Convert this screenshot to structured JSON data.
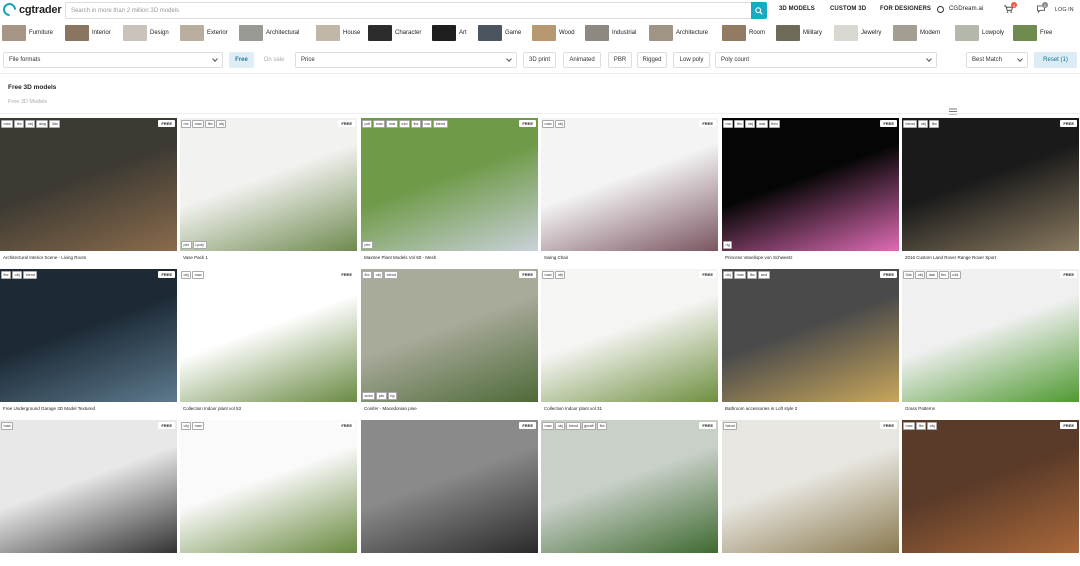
{
  "header": {
    "logo_text": "cgtrader",
    "search_placeholder": "Search in more than 2 million 3D models",
    "nav": [
      "3D MODELS",
      "CUSTOM 3D",
      "FOR DESIGNERS",
      "CGDream.ai"
    ],
    "cart_count": "0",
    "user_count": "0",
    "login_label": "LOG IN"
  },
  "categories": [
    {
      "label": "Furniture",
      "color": "#a79686"
    },
    {
      "label": "Interior",
      "color": "#8a7560"
    },
    {
      "label": "Design",
      "color": "#c9c3bb"
    },
    {
      "label": "Exterior",
      "color": "#b9ad9d"
    },
    {
      "label": "Architectural",
      "color": "#9a9a95"
    },
    {
      "label": "House",
      "color": "#c0b7a8"
    },
    {
      "label": "Character",
      "color": "#2c2c2c"
    },
    {
      "label": "Art",
      "color": "#1e1e1e"
    },
    {
      "label": "Game",
      "color": "#4b5560"
    },
    {
      "label": "Wood",
      "color": "#b89870"
    },
    {
      "label": "Industrial",
      "color": "#8d8880"
    },
    {
      "label": "Architecture",
      "color": "#a09585"
    },
    {
      "label": "Room",
      "color": "#937a63"
    },
    {
      "label": "Military",
      "color": "#6e6a58"
    },
    {
      "label": "Jewelry",
      "color": "#d8d8d0"
    },
    {
      "label": "Modern",
      "color": "#a49d92"
    },
    {
      "label": "Lowpoly",
      "color": "#b3b9aa"
    },
    {
      "label": "Free",
      "color": "#6f8b4e"
    }
  ],
  "filters": {
    "file_formats": "File formats",
    "free": "Free",
    "on_sale": "On sale",
    "price": "Price",
    "print3d": "3D print",
    "animated": "Animated",
    "pbr": "PBR",
    "rigged": "Rigged",
    "lowpoly": "Low poly",
    "poly_count": "Poly count",
    "sort": "Best Match",
    "reset": "Reset (1)"
  },
  "page": {
    "title": "Free 3D models",
    "breadcrumb": "Free 3D Models"
  },
  "free_label": "FREE",
  "products": [
    {
      "title": "Architectural Interior Scene - Living Room",
      "formats": [
        "max",
        "fbx",
        "obj",
        "dwg",
        "3ds"
      ],
      "bottom": [],
      "bg": "#3d3a33",
      "bg2": "#8a6b4c"
    },
    {
      "title": "Vase Pack 1",
      "formats": [
        "mx",
        "max",
        "fbx",
        "obj"
      ],
      "bottom": [
        "pbr",
        "l-poly"
      ],
      "bg": "#f2f2f0",
      "bg2": "#6f8a50"
    },
    {
      "title": "Maxtree Plant Models Vol 60 - Mesh",
      "formats": [
        "pdf",
        "max",
        "mat",
        "c4d",
        "fbx",
        "ma",
        "blend"
      ],
      "bottom": [
        "pbr"
      ],
      "bg": "#6f9a48",
      "bg2": "#c9d1d9"
    },
    {
      "title": "Swing Chair",
      "formats": [
        "max",
        "obj"
      ],
      "bottom": [],
      "bg": "#f4f4f4",
      "bg2": "#7a5560"
    },
    {
      "title": "Princess Vanellope von Schweetz",
      "formats": [
        "ma",
        "fbx",
        "obj",
        "mat",
        "fbm"
      ],
      "bottom": [
        "rig"
      ],
      "bg": "#050505",
      "bg2": "#e06bb5"
    },
    {
      "title": "2016 Custom Land Rover Range Rover Sport",
      "formats": [
        "blend",
        "obj",
        "fbx"
      ],
      "bottom": [],
      "bg": "#1a1a1a",
      "bg2": "#8a7a60"
    },
    {
      "title": "Free Underground Garage 3D Model Textured",
      "formats": [
        "fbx",
        "obj",
        "blend"
      ],
      "bottom": [],
      "bg": "#1d2a36",
      "bg2": "#5d7a8e"
    },
    {
      "title": "Collection Indoor plant vol 53",
      "formats": [
        "obj",
        "max"
      ],
      "bottom": [],
      "bg": "#ffffff",
      "bg2": "#6a8a44"
    },
    {
      "title": "Conifer - Macedonian pine",
      "formats": [
        "fbx",
        "obj",
        "blend"
      ],
      "bottom": [
        "anim",
        "pbr",
        "rig"
      ],
      "bg": "#a8aa9a",
      "bg2": "#4e6a38"
    },
    {
      "title": "Collection Indoor plant vol 31",
      "formats": [
        "max",
        "obj"
      ],
      "bottom": [],
      "bg": "#f5f5f3",
      "bg2": "#6f8f40"
    },
    {
      "title": "Bathroom accessories in Loft style 2",
      "formats": [
        "obj",
        "max",
        "fbx",
        "and"
      ],
      "bottom": [],
      "bg": "#4a4a4a",
      "bg2": "#c7a65a"
    },
    {
      "title": "Grass Patterns",
      "formats": [
        "3ds",
        "obj",
        "dae",
        "fbx",
        "c4d"
      ],
      "bottom": [],
      "bg": "#f0f0f0",
      "bg2": "#4f9a30"
    },
    {
      "title": "",
      "formats": [
        "max"
      ],
      "bottom": [],
      "bg": "#e8e8e8",
      "bg2": "#333333"
    },
    {
      "title": "",
      "formats": [
        "obj",
        "max"
      ],
      "bottom": [],
      "bg": "#fafafa",
      "bg2": "#6a8a40"
    },
    {
      "title": "",
      "formats": [],
      "bottom": [],
      "bg": "#8a8a8a",
      "bg2": "#2a2a2a"
    },
    {
      "title": "",
      "formats": [
        "max",
        "obj",
        "blend",
        "gmaft",
        "fbx"
      ],
      "bottom": [],
      "bg": "#c8d0c8",
      "bg2": "#3f6a30"
    },
    {
      "title": "",
      "formats": [
        "blend"
      ],
      "bottom": [],
      "bg": "#e8e6e0",
      "bg2": "#8a7a50"
    },
    {
      "title": "",
      "formats": [
        "max",
        "fbx",
        "obj"
      ],
      "bottom": [],
      "bg": "#5a3a28",
      "bg2": "#a8683a"
    }
  ]
}
